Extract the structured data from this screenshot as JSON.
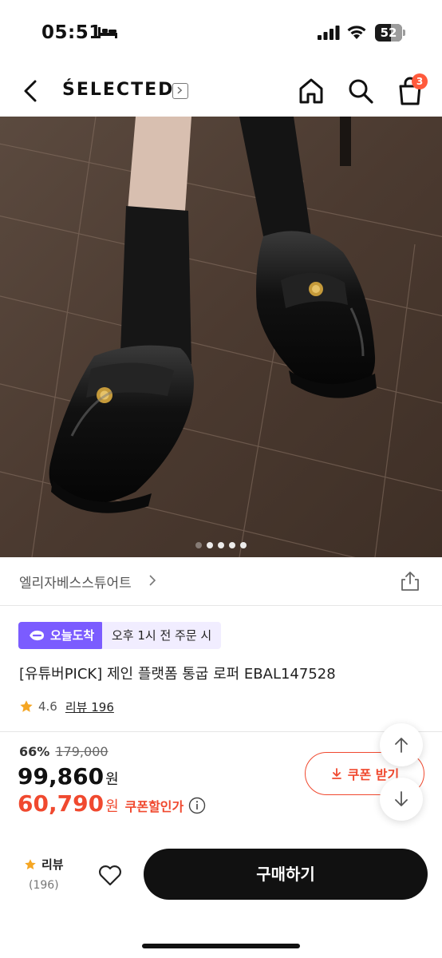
{
  "status_bar": {
    "time": "05:51",
    "battery": "52"
  },
  "header": {
    "brand": "ŚELECTED",
    "cart_count": "3"
  },
  "hero": {
    "slide_total": 5,
    "slide_active": 1
  },
  "store": {
    "name": "엘리자베스스튜어트"
  },
  "delivery": {
    "badge": "오늘도착",
    "cutoff": "오후 1시 전 주문 시"
  },
  "product": {
    "title": "[유튜버PICK] 제인 플랫폼 통굽 로퍼 EBAL147528",
    "rating": "4.6",
    "review_label": "리뷰 196"
  },
  "price": {
    "discount_rate": "66%",
    "original": "179,000",
    "sale": "99,860",
    "unit": "원",
    "coupon_price": "60,790",
    "coupon_label": "쿠폰할인가"
  },
  "coupon_button": {
    "label": "쿠폰 받기"
  },
  "bottom_bar": {
    "review_label": "리뷰",
    "review_count": "(196)",
    "buy_label": "구매하기"
  },
  "colors": {
    "accent_red": "#f0492f",
    "delivery_purple": "#7b5cff",
    "star": "#f5a623"
  }
}
